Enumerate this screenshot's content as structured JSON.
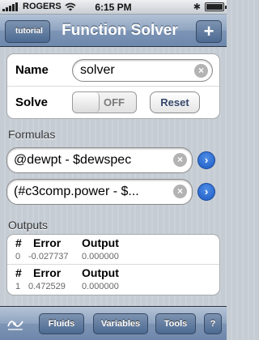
{
  "status": {
    "carrier": "ROGERS",
    "time": "6:15 PM"
  },
  "nav": {
    "back_label": "tutorial",
    "title": "Function Solver",
    "add_label": "+"
  },
  "solver": {
    "name_label": "Name",
    "name_value": "solver",
    "solve_label": "Solve",
    "solve_toggle_text": "OFF",
    "reset_label": "Reset"
  },
  "formulas": {
    "header": "Formulas",
    "items": [
      {
        "text": "@dewpt - $dewspec"
      },
      {
        "text": "(#c3comp.power - $..."
      }
    ]
  },
  "outputs": {
    "header": "Outputs",
    "columns": [
      "#",
      "Error",
      "Output"
    ],
    "rows": [
      {
        "index": "0",
        "error": "-0.027737",
        "output": "0.000000"
      },
      {
        "index": "1",
        "error": "0.472529",
        "output": "0.000000"
      }
    ]
  },
  "toolbar": {
    "fluids_label": "Fluids",
    "variables_label": "Variables",
    "tools_label": "Tools",
    "help_label": "?"
  },
  "icons": {
    "clear": "clear-field-icon",
    "disclosure": "detail-disclosure-icon",
    "function": "function-graph-icon"
  }
}
